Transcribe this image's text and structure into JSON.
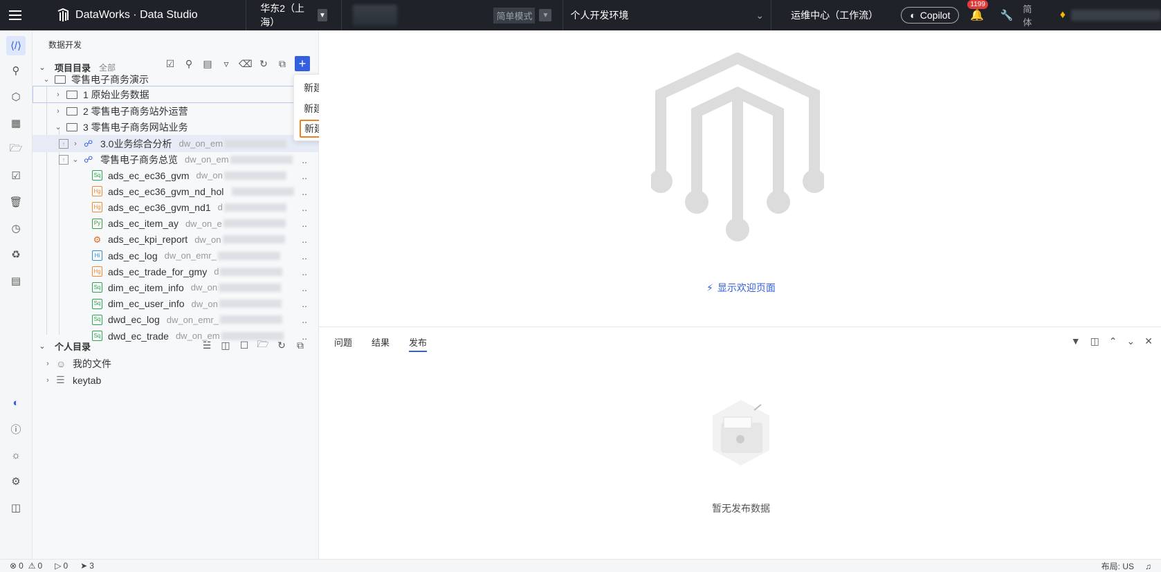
{
  "topbar": {
    "brand": "DataWorks · Data Studio",
    "region": "华东2（上海）",
    "mode": "简单模式",
    "environment": "个人开发环境",
    "ops_center": "运维中心（工作流）",
    "copilot": "Copilot",
    "notification_count": "1199",
    "language": "简体"
  },
  "rail": {
    "icons": [
      "code-icon",
      "ai-icon",
      "box-icon",
      "table-icon",
      "folder-icon",
      "check-icon",
      "trash-icon",
      "clock-icon",
      "stamp-icon",
      "message-icon",
      "copilot-icon",
      "help-icon",
      "theme-icon",
      "settings-icon",
      "collapse-icon"
    ]
  },
  "sidebar": {
    "title": "数据开发",
    "project_dir": {
      "label": "项目目录",
      "scope": "全部"
    },
    "tree": {
      "root": "零售电子商务演示",
      "folders": [
        "1 原始业务数据",
        "2 零售电子商务站外运营",
        "3 零售电子商务网站业务"
      ],
      "workflows": [
        {
          "name": "3.0业务综合分析",
          "ds": "dw_on_em"
        },
        {
          "name": "零售电子商务总览",
          "ds": "dw_on_em"
        }
      ],
      "files": [
        {
          "tag": "Sq",
          "name": "ads_ec_ec36_gvm",
          "ds": "dw_on"
        },
        {
          "tag": "Hg",
          "name": "ads_ec_ec36_gvm_nd_hol",
          "ds": ""
        },
        {
          "tag": "Hg",
          "name": "ads_ec_ec36_gvm_nd1",
          "ds": "d"
        },
        {
          "tag": "Py",
          "name": "ads_ec_item_ay",
          "ds": "dw_on_e"
        },
        {
          "tag": "Sp",
          "name": "ads_ec_kpi_report",
          "ds": "dw_on"
        },
        {
          "tag": "Hi",
          "name": "ads_ec_log",
          "ds": "dw_on_emr_"
        },
        {
          "tag": "Hg",
          "name": "ads_ec_trade_for_gmy",
          "ds": "d"
        },
        {
          "tag": "Sq",
          "name": "dim_ec_item_info",
          "ds": "dw_on"
        },
        {
          "tag": "Sq",
          "name": "dim_ec_user_info",
          "ds": "dw_on"
        },
        {
          "tag": "Sq",
          "name": "dwd_ec_log",
          "ds": "dw_on_emr_"
        },
        {
          "tag": "Sq",
          "name": "dwd_ec_trade",
          "ds": "dw_on_em"
        }
      ]
    },
    "personal_dir": {
      "label": "个人目录",
      "items": [
        "我的文件",
        "keytab"
      ]
    }
  },
  "context_menu": {
    "items": [
      "新建节点...",
      "新建工作流...",
      "新建目录..."
    ]
  },
  "main": {
    "welcome_link": "显示欢迎页面"
  },
  "panel": {
    "tabs": [
      "问题",
      "结果",
      "发布"
    ],
    "active_tab": "发布",
    "empty_text": "暂无发布数据"
  },
  "statusbar": {
    "errors": "0",
    "warnings": "0",
    "runs": "0",
    "deploys": "3",
    "layout": "布局: US"
  }
}
